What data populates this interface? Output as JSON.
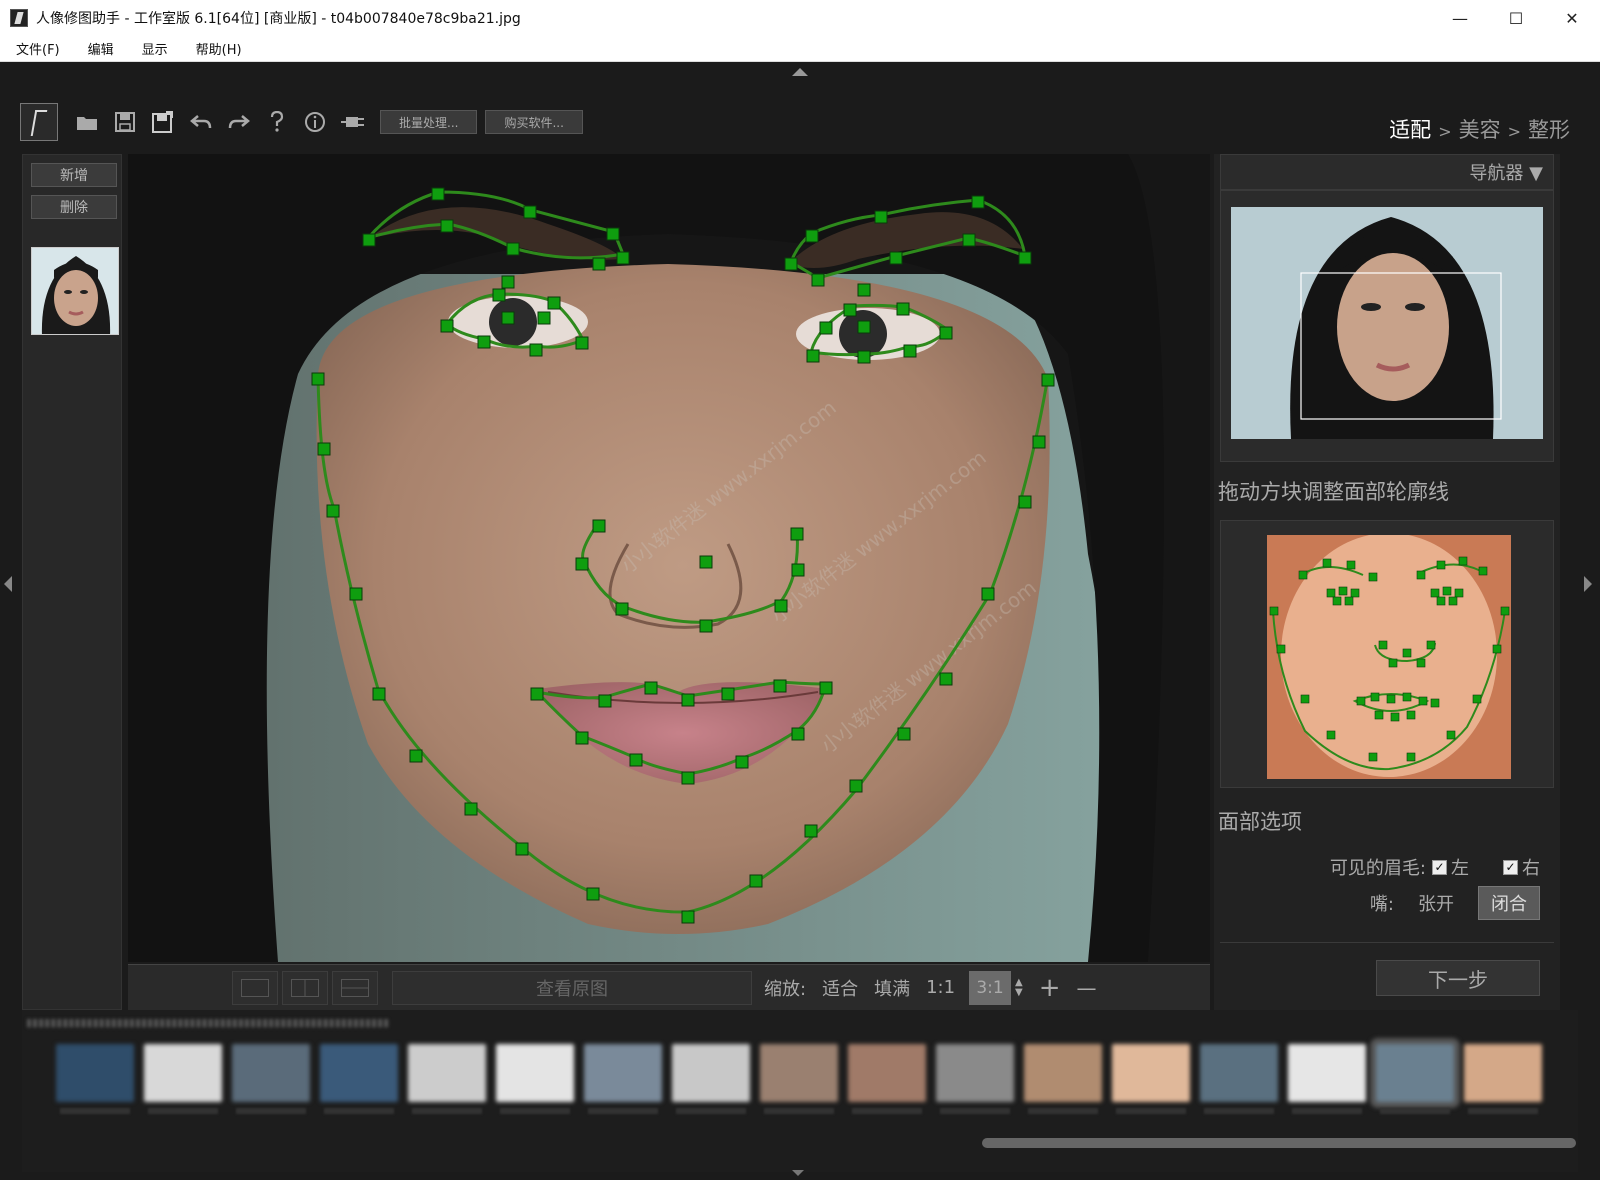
{
  "window": {
    "title": "人像修图助手 - 工作室版 6.1[64位] [商业版] - t04b007840e78c9ba21.jpg",
    "minimize": "—",
    "maximize": "☐",
    "close": "✕"
  },
  "menu": [
    "文件(F)",
    "编辑",
    "显示",
    "帮助(H)"
  ],
  "toolbar": {
    "icons": [
      "open-folder-icon",
      "save-icon",
      "save-as-icon",
      "undo-icon",
      "redo-icon",
      "help-icon",
      "info-icon",
      "plugin-icon"
    ],
    "batch_label": "批量处理...",
    "buy_label": "购买软件..."
  },
  "breadcrumb": {
    "steps": [
      "适配",
      "美容",
      "整形"
    ],
    "separator": ">",
    "active_index": 0
  },
  "left_panel": {
    "add_label": "新增",
    "delete_label": "删除"
  },
  "viewer": {
    "watermark_lines": [
      "小小软件迷 www.xxrjm.com",
      "小小软件迷 www.xxrjm.com",
      "小小软件迷 www.xxrjm.com"
    ]
  },
  "viewer_bottom": {
    "view_original": "查看原图",
    "zoom_label": "缩放:",
    "fit_label": "适合",
    "fill_label": "填满",
    "one_to_one": "1:1",
    "three_to_one": "3:1",
    "plus": "+",
    "minus": "—"
  },
  "right_panel": {
    "navigator_label": "导航器 ▼",
    "hint_title": "拖动方块调整面部轮廓线",
    "face_options_title": "面部选项",
    "eyebrows_label": "可见的眉毛:",
    "left_label": "左",
    "right_label": "右",
    "mouth_label": "嘴:",
    "mouth_open": "张开",
    "mouth_closed": "闭合",
    "checkmark": "✓",
    "next_label": "下一步"
  },
  "colors": {
    "accent_green": "#2a8a1a",
    "handle_green": "#0f9e0f",
    "panel_bg": "#222222"
  }
}
